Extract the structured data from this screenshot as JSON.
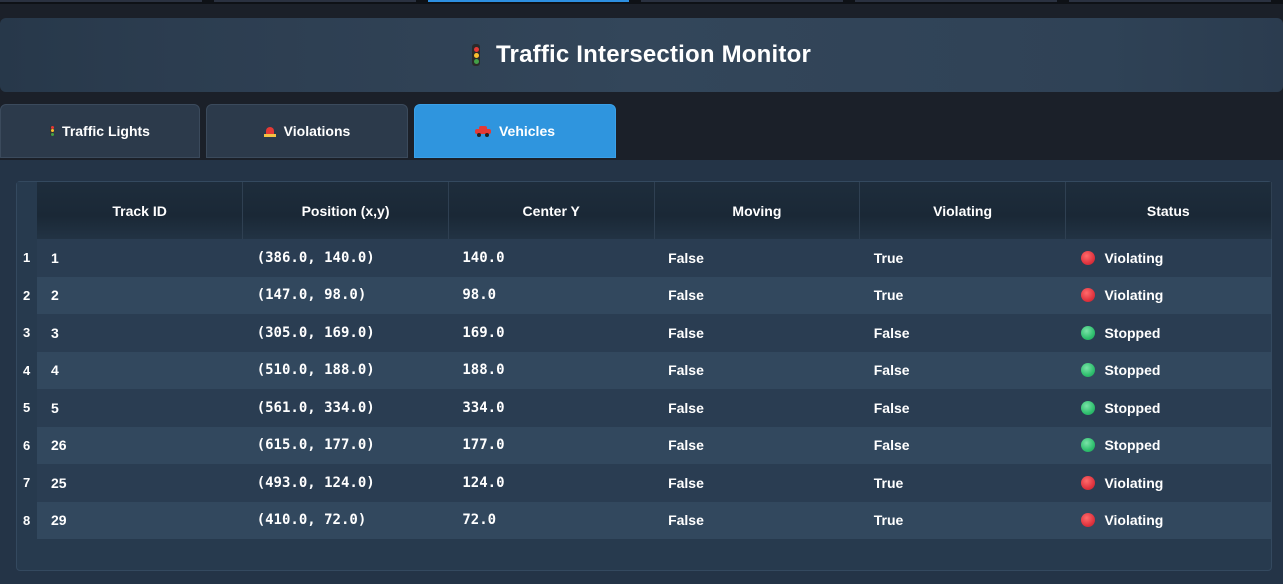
{
  "header": {
    "title": "Traffic Intersection Monitor",
    "icon": "traffic-light-icon"
  },
  "tabs": [
    {
      "label": "Traffic Lights",
      "icon": "traffic-light-icon",
      "active": false
    },
    {
      "label": "Violations",
      "icon": "siren-icon",
      "active": false
    },
    {
      "label": "Vehicles",
      "icon": "car-icon",
      "active": true
    }
  ],
  "table": {
    "columns": [
      "Track ID",
      "Position (x,y)",
      "Center Y",
      "Moving",
      "Violating",
      "Status"
    ],
    "rows": [
      {
        "index": "1",
        "track_id": "1",
        "position": "(386.0, 140.0)",
        "center_y": "140.0",
        "moving": "False",
        "violating": "True",
        "status": "Violating",
        "status_color": "#e0343f"
      },
      {
        "index": "2",
        "track_id": "2",
        "position": "(147.0, 98.0)",
        "center_y": "98.0",
        "moving": "False",
        "violating": "True",
        "status": "Violating",
        "status_color": "#e0343f"
      },
      {
        "index": "3",
        "track_id": "3",
        "position": "(305.0, 169.0)",
        "center_y": "169.0",
        "moving": "False",
        "violating": "False",
        "status": "Stopped",
        "status_color": "#2fbf6e"
      },
      {
        "index": "4",
        "track_id": "4",
        "position": "(510.0, 188.0)",
        "center_y": "188.0",
        "moving": "False",
        "violating": "False",
        "status": "Stopped",
        "status_color": "#2fbf6e"
      },
      {
        "index": "5",
        "track_id": "5",
        "position": "(561.0, 334.0)",
        "center_y": "334.0",
        "moving": "False",
        "violating": "False",
        "status": "Stopped",
        "status_color": "#2fbf6e"
      },
      {
        "index": "6",
        "track_id": "26",
        "position": "(615.0, 177.0)",
        "center_y": "177.0",
        "moving": "False",
        "violating": "False",
        "status": "Stopped",
        "status_color": "#2fbf6e"
      },
      {
        "index": "7",
        "track_id": "25",
        "position": "(493.0, 124.0)",
        "center_y": "124.0",
        "moving": "False",
        "violating": "True",
        "status": "Violating",
        "status_color": "#e0343f"
      },
      {
        "index": "8",
        "track_id": "29",
        "position": "(410.0, 72.0)",
        "center_y": "72.0",
        "moving": "False",
        "violating": "True",
        "status": "Violating",
        "status_color": "#e0343f"
      }
    ]
  },
  "colors": {
    "accent": "#2f95de",
    "violating": "#e0343f",
    "stopped": "#2fbf6e"
  }
}
